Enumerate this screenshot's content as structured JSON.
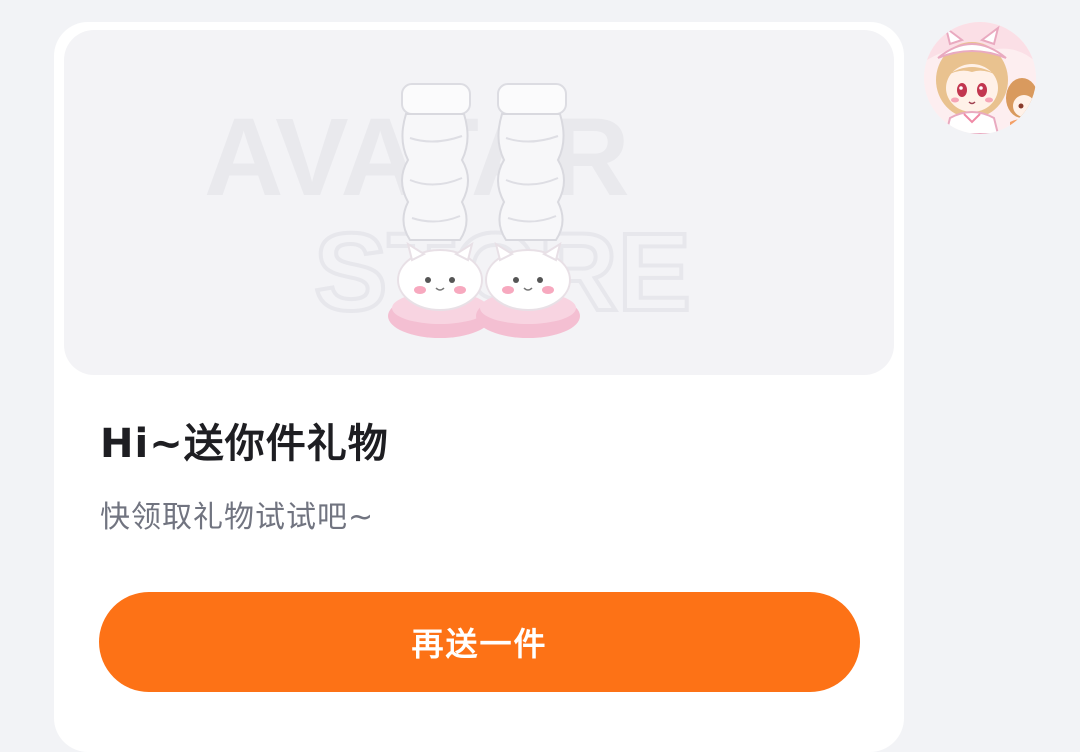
{
  "gift_card": {
    "title": "Hi~送你件礼物",
    "subtitle": "快领取礼物试试吧~",
    "action_label": "再送一件",
    "watermark": [
      "AVATAR",
      "STORE"
    ],
    "item_icon": "leg-warmers-bunny-slippers-image"
  },
  "sender": {
    "avatar_icon": "anime-girl-avatar"
  },
  "colors": {
    "accent": "#fd7216",
    "page_background": "#f2f3f6",
    "card_background": "#ffffff",
    "title_text": "#1e1e22",
    "subtitle_text": "#717480"
  }
}
